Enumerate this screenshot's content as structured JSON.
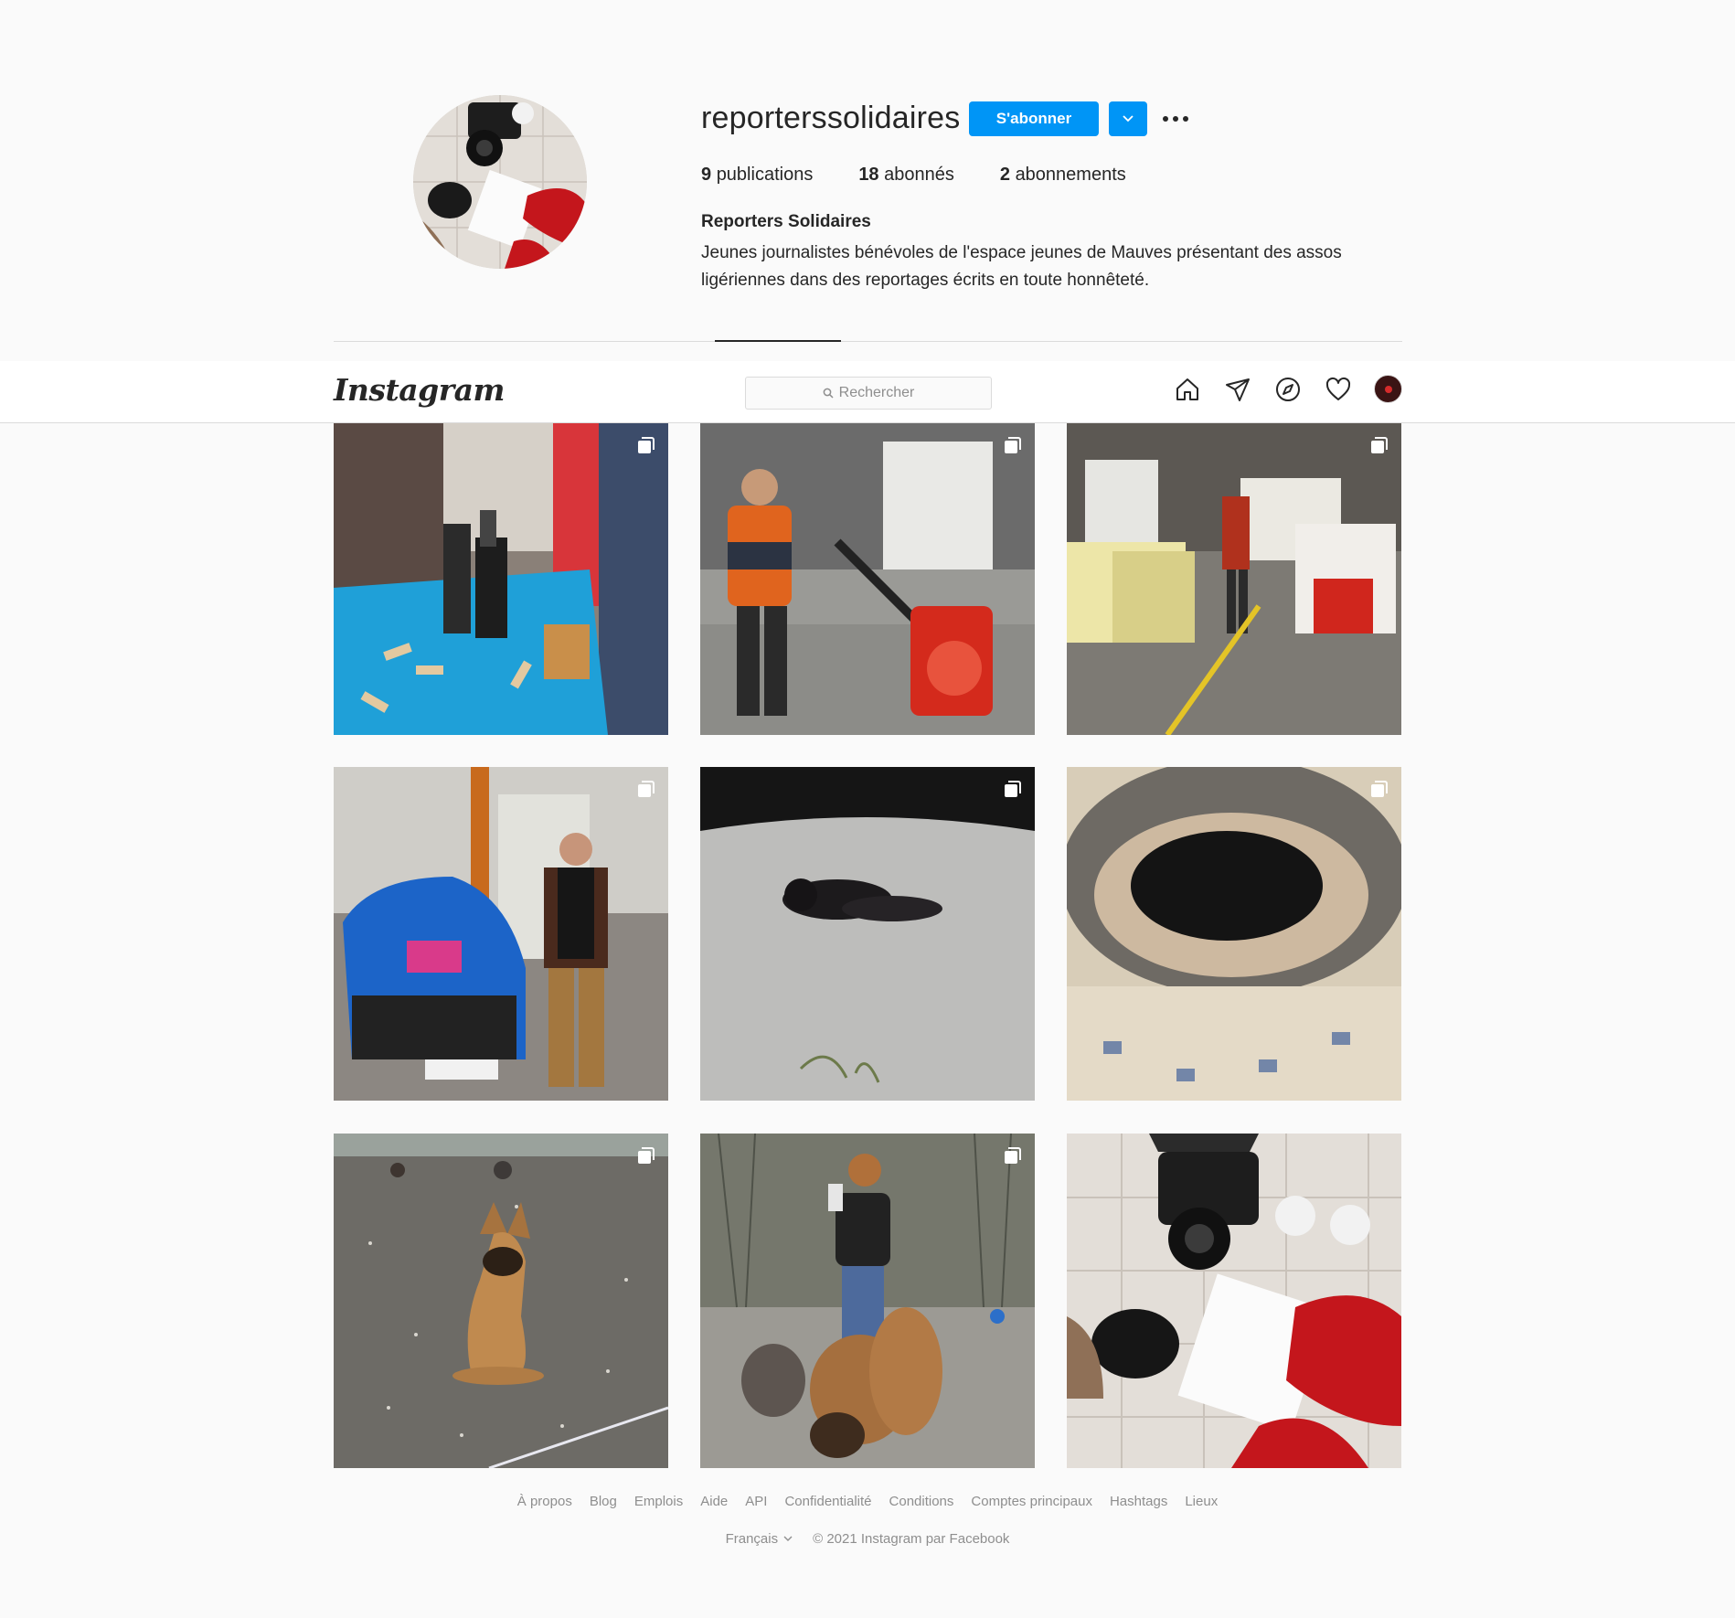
{
  "profile": {
    "username": "reporterssolidaires",
    "follow_label": "S'abonner",
    "stats": {
      "posts_count": "9",
      "posts_label": "publications",
      "followers_count": "18",
      "followers_label": "abonnés",
      "following_count": "2",
      "following_label": "abonnements"
    },
    "full_name": "Reporters Solidaires",
    "bio_line1": "Jeunes journalistes bénévoles de l'espace jeunes de Mauves présentant des assos",
    "bio_line2": "ligériennes dans des reportages écrits en toute honnêteté."
  },
  "navbar": {
    "logo": "Instagram",
    "search_placeholder": "Rechercher",
    "icons": [
      "home-icon",
      "direct-icon",
      "explore-icon",
      "activity-icon",
      "profile-avatar"
    ]
  },
  "posts": [
    {
      "subject": "game-table",
      "multi": true
    },
    {
      "subject": "man-pallet-truck",
      "multi": true
    },
    {
      "subject": "warehouse",
      "multi": true
    },
    {
      "subject": "man-blue-car",
      "multi": true
    },
    {
      "subject": "black-cat",
      "multi": true
    },
    {
      "subject": "dog-basket",
      "multi": true
    },
    {
      "subject": "malinois-dog",
      "multi": true
    },
    {
      "subject": "woman-dogs",
      "multi": true
    },
    {
      "subject": "camera-microphone",
      "multi": false
    }
  ],
  "footer": {
    "links": [
      "À propos",
      "Blog",
      "Emplois",
      "Aide",
      "API",
      "Confidentialité",
      "Conditions",
      "Comptes principaux",
      "Hashtags",
      "Lieux"
    ],
    "language": "Français",
    "copyright": "© 2021 Instagram par Facebook"
  },
  "colors": {
    "accent": "#0095f6",
    "text": "#262626",
    "muted": "#8e8e8e",
    "border": "#dbdbdb",
    "background": "#fafafa"
  }
}
